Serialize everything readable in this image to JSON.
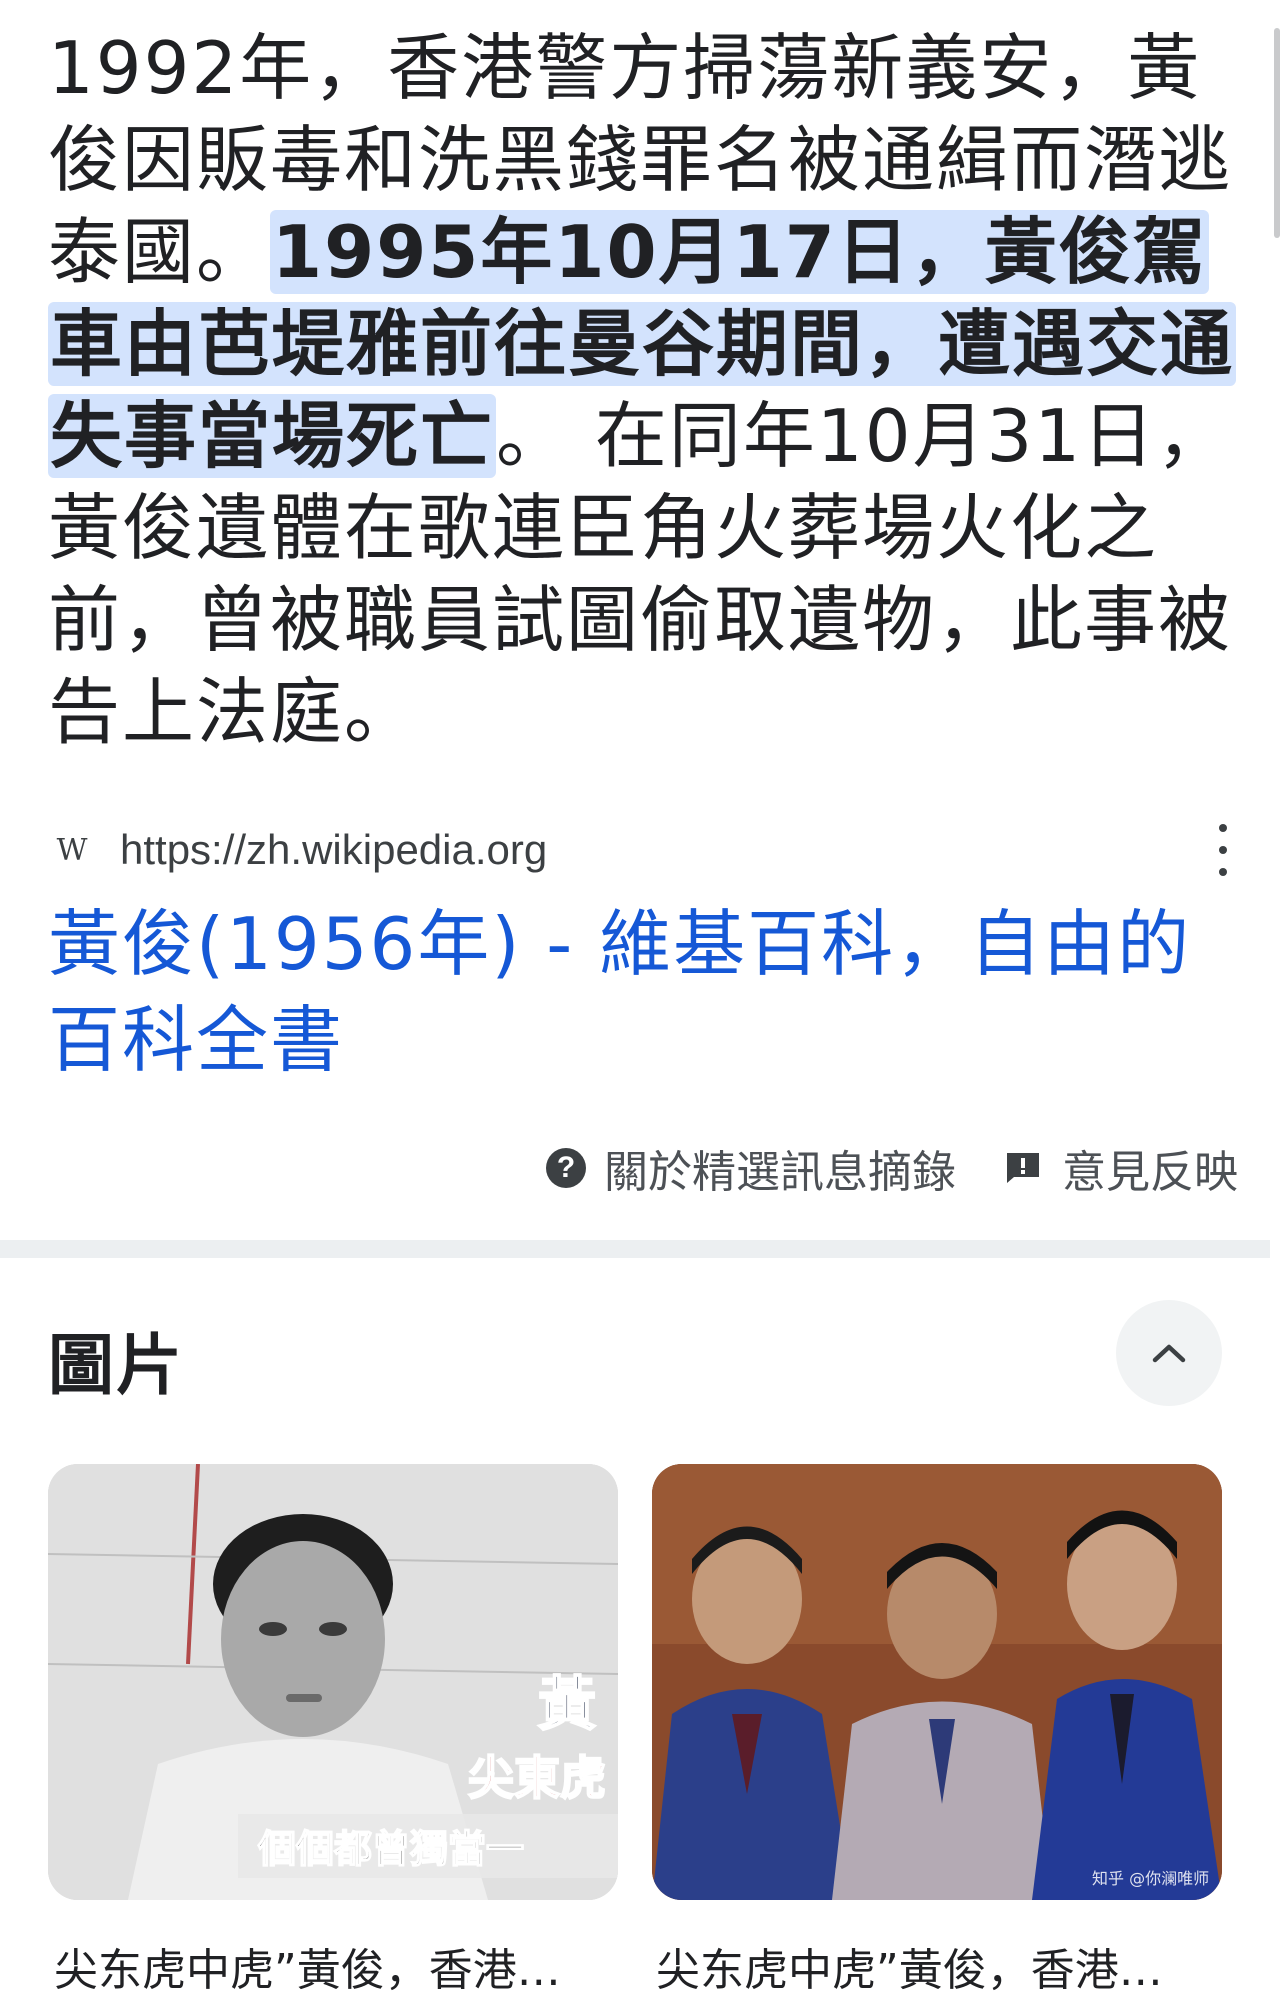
{
  "snippet": {
    "text_before": "1992年，香港警方掃蕩新義安，黃俊因販毒和洗黑錢罪名被通緝而潛逃泰國。",
    "text_highlight": "1995年10月17日，黃俊駕車由芭堤雅前往曼谷期間，遭遇交通失事當場死亡",
    "text_after": "。 在同年10月31日，黃俊遺體在歌連臣角火葬場火化之前，曾被職員試圖偷取遺物，此事被告上法庭。"
  },
  "source": {
    "favicon_letter": "W",
    "url": "https://zh.wikipedia.org"
  },
  "result": {
    "title": "黃俊(1956年) - 維基百科，自由的百科全書"
  },
  "footer": {
    "about_label": "關於精選訊息摘錄",
    "feedback_label": "意見反映"
  },
  "images": {
    "heading": "圖片",
    "items": [
      {
        "caption": "尖东虎中虎”黃俊，香港…",
        "overlay_name": "黃",
        "overlay_sub": "尖東虎",
        "overlay_bottom": "個個都曾獨當一"
      },
      {
        "caption": "尖东虎中虎”黃俊，香港…",
        "watermark": "知乎 @你澜唯师"
      }
    ]
  },
  "colors": {
    "highlight": "#d3e3fd",
    "link": "#1558d6",
    "divider": "#eceff1"
  },
  "icons": {
    "favicon": "wikipedia-icon",
    "more": "more-vert-icon",
    "help": "help-icon",
    "feedback": "feedback-icon",
    "collapse": "chevron-up-icon"
  }
}
